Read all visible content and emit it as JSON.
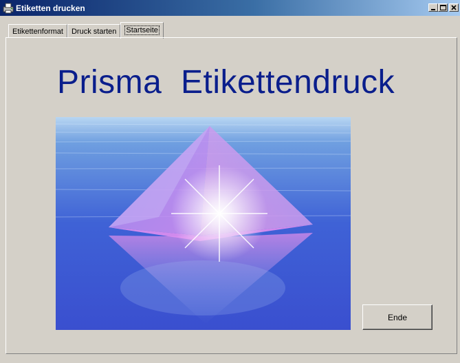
{
  "window": {
    "title": "Etiketten drucken",
    "icon": "printer-app-icon"
  },
  "titlebar_buttons": {
    "minimize_icon": "minimize-icon",
    "maximize_icon": "maximize-icon",
    "close_icon": "close-icon"
  },
  "tabs": [
    {
      "label": "Etikettenformat",
      "active": false
    },
    {
      "label": "Druck starten",
      "active": false
    },
    {
      "label": "Startseite",
      "active": true
    }
  ],
  "main": {
    "headline": "Prisma  Etikettendruck",
    "picture": "prism-pyramid-over-water-image",
    "end_button": "Ende"
  },
  "colors": {
    "headline": "#0a1e8c",
    "titlebar_start": "#0a246a",
    "titlebar_end": "#a6caf0",
    "face": "#d4d0c8"
  }
}
